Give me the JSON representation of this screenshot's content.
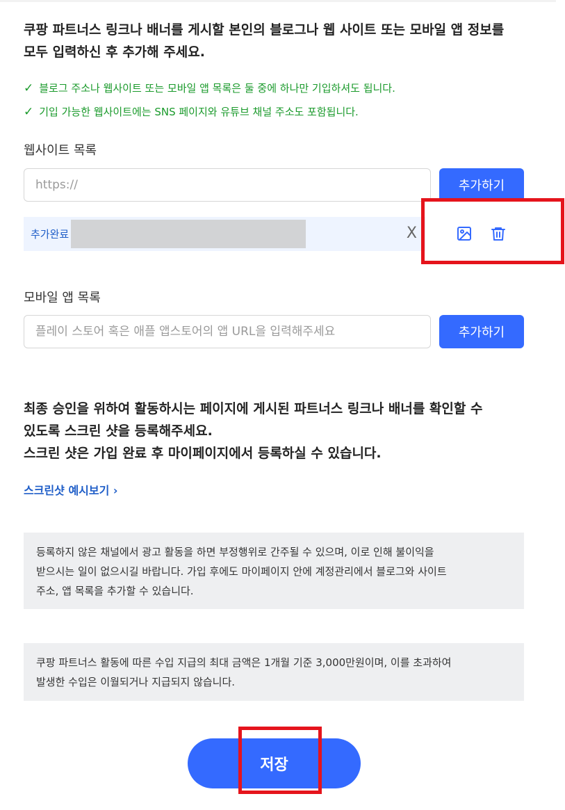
{
  "intro": {
    "line1": "쿠팡 파트너스 링크나 배너를 게시할 본인의 블로그나 웹 사이트 또는 모바일 앱 정보를",
    "line2": "모두 입력하신 후 추가해 주세요."
  },
  "checks": [
    "블로그 주소나 웹사이트 또는 모바일 앱 목록은 둘 중에 하나만 기입하셔도 됩니다.",
    "기입 가능한 웹사이트에는 SNS 페이지와 유튜브 채널 주소도 포함됩니다."
  ],
  "website": {
    "label": "웹사이트 목록",
    "placeholder": "https://",
    "add_label": "추가하기",
    "added_label": "추가완료",
    "remove_symbol": "X"
  },
  "mobile": {
    "label": "모바일 앱 목록",
    "placeholder": "플레이 스토어 혹은 애플 앱스토어의 앱 URL을 입력해주세요",
    "add_label": "추가하기"
  },
  "screenshot_notice": {
    "line1": "최종 승인을 위하여 활동하시는 페이지에 게시된 파트너스 링크나 배너를 확인할 수",
    "line2": "있도록 스크린 샷을 등록해주세요.",
    "line3": "스크린 샷은 가입 완료 후 마이페이지에서 등록하실 수 있습니다."
  },
  "preview_link": "스크린샷 예시보기 ›",
  "info_boxes": [
    {
      "lines": [
        "등록하지 않은 채널에서 광고 활동을 하면 부정행위로 간주될 수 있으며, 이로 인해 불이익을",
        "받으시는 일이 없으시길 바랍니다. 가입 후에도 마이페이지 안에 계정관리에서 블로그와 사이트",
        "주소, 앱 목록을 추가할 수 있습니다."
      ]
    },
    {
      "lines": [
        "쿠팡 파트너스 활동에 따른 수입 지급의 최대 금액은 1개월 기준 3,000만원이며, 이를 초과하여",
        "발생한 수입은 이월되거나 지급되지 않습니다."
      ]
    }
  ],
  "save_label": "저장",
  "colors": {
    "accent": "#346aff",
    "check_green": "#1a9a2b",
    "link_blue": "#1f5ec8",
    "highlight_red": "#e5141c"
  },
  "icons": {
    "image": "image-icon",
    "trash": "trash-icon",
    "check": "check-icon"
  }
}
